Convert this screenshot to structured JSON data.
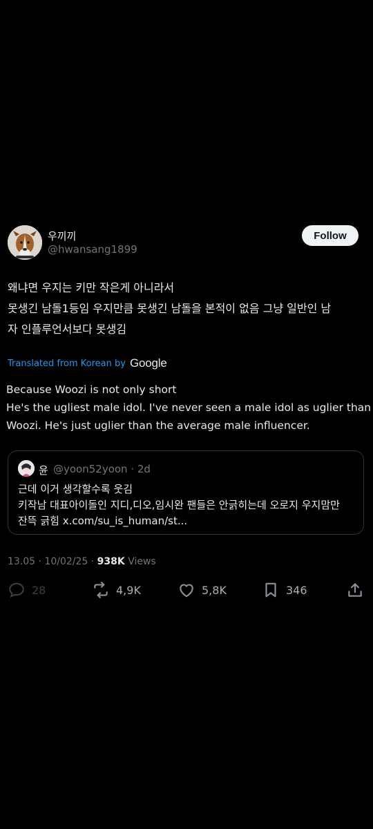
{
  "author": {
    "name": "우끼끼",
    "handle": "@hwansang1899",
    "follow_label": "Follow"
  },
  "tweet": {
    "lines": [
      "왜냐면 우지는 키만 작은게 아니라서",
      "못생긴 남돌1등임 우지만큼 못생긴 남돌을 본적이 없음 그냥 일반인 남",
      "자 인플루언서보다 못생김"
    ],
    "translation_label": "Translated from Korean by",
    "translation_provider": "Google",
    "translated_lines": [
      "Because Woozi is not only short",
      "He's the ugliest male idol. I've never seen a male idol as uglier than",
      "Woozi. He's just uglier than the average male influencer."
    ]
  },
  "quote": {
    "name": "윤",
    "handle_time": "@yoon52yoon · 2d",
    "lines": [
      "근데 이거 생각할수록 웃김",
      "키작남 대표아이돌인 지디,디오,임시완 팬들은 안긁히는데 오로지 우지맘만",
      "잔뜩 긁힘 x.com/su_is_human/st..."
    ]
  },
  "meta": {
    "time_date": "13.05 · 10/02/25 · ",
    "views_count": "938K",
    "views_label": " Views"
  },
  "actions": {
    "replies": "28",
    "reposts": "4,9K",
    "likes": "5,8K",
    "bookmarks": "346"
  },
  "colors": {
    "background": "#000000",
    "text": "#e7e9ea",
    "secondary": "#71767b",
    "link": "#1d9bf0",
    "border": "#2f3336"
  },
  "icons": [
    "reply-icon",
    "repost-icon",
    "like-icon",
    "bookmark-icon",
    "share-icon"
  ]
}
